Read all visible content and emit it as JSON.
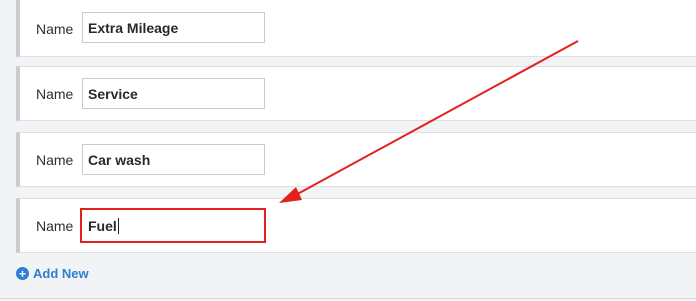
{
  "rows": [
    {
      "label": "Name",
      "value": "Extra Mileage"
    },
    {
      "label": "Name",
      "value": "Service"
    },
    {
      "label": "Name",
      "value": "Car wash"
    },
    {
      "label": "Name",
      "value": "Fuel"
    }
  ],
  "add_new": {
    "label": "Add New",
    "icon": "plus-circle-icon"
  },
  "colors": {
    "accent": "#2d7fd1",
    "annotation": "#e2211c"
  }
}
